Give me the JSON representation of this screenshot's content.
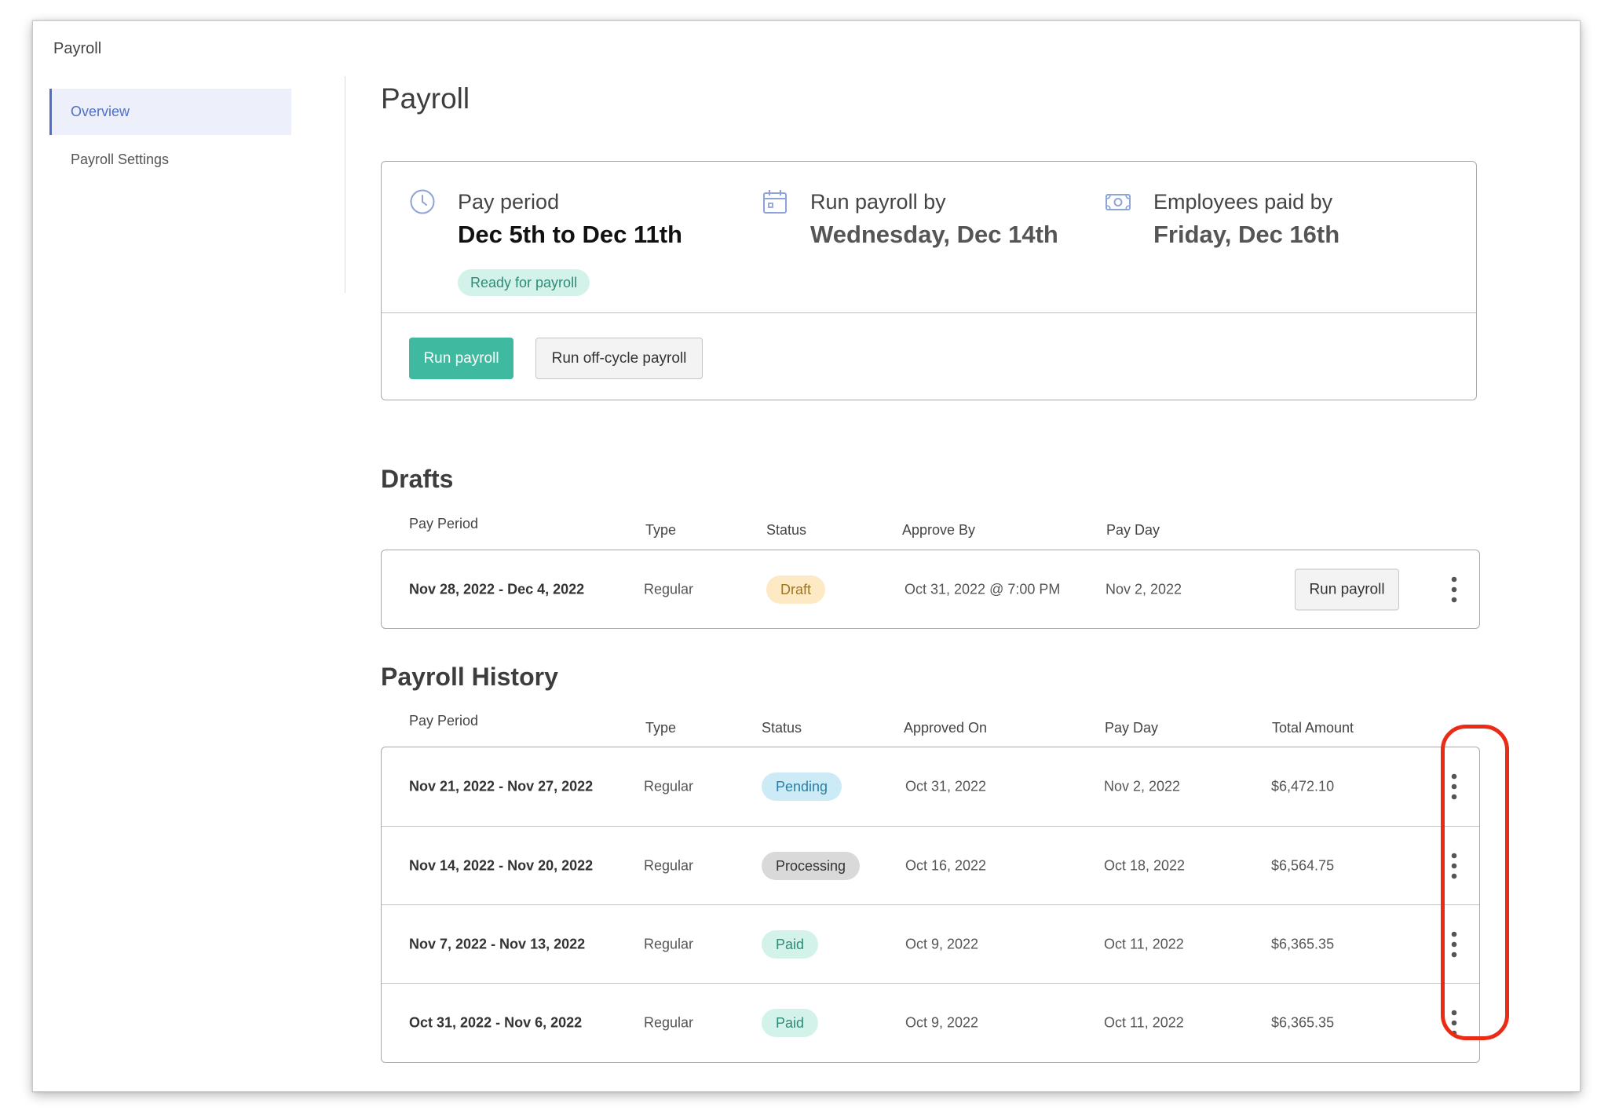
{
  "app": {
    "title": "Payroll"
  },
  "sidebar": {
    "items": [
      {
        "label": "Overview",
        "active": true
      },
      {
        "label": "Payroll Settings",
        "active": false
      }
    ]
  },
  "page": {
    "title": "Payroll"
  },
  "pay_period_card": {
    "pay_period_label": "Pay period",
    "pay_period_value": "Dec 5th to Dec 11th",
    "status_badge": "Ready for payroll",
    "run_by_label": "Run payroll by",
    "run_by_value": "Wednesday, Dec 14th",
    "paid_by_label": "Employees paid by",
    "paid_by_value": "Friday, Dec 16th",
    "run_payroll_button": "Run payroll",
    "off_cycle_button": "Run off-cycle payroll"
  },
  "drafts": {
    "title": "Drafts",
    "columns": [
      "Pay Period",
      "Type",
      "Status",
      "Approve By",
      "Pay Day"
    ],
    "rows": [
      {
        "pay_period": "Nov 28, 2022 - Dec 4, 2022",
        "type": "Regular",
        "status": "Draft",
        "approve_by": "Oct 31, 2022 @ 7:00 PM",
        "pay_day": "Nov 2, 2022",
        "action": "Run payroll"
      }
    ]
  },
  "history": {
    "title": "Payroll History",
    "columns": [
      "Pay Period",
      "Type",
      "Status",
      "Approved On",
      "Pay Day",
      "Total Amount"
    ],
    "rows": [
      {
        "pay_period": "Nov 21, 2022 - Nov 27, 2022",
        "type": "Regular",
        "status": "Pending",
        "approved_on": "Oct 31, 2022",
        "pay_day": "Nov 2, 2022",
        "total": "$6,472.10"
      },
      {
        "pay_period": "Nov 14, 2022 - Nov 20, 2022",
        "type": "Regular",
        "status": "Processing",
        "approved_on": "Oct 16, 2022",
        "pay_day": "Oct 18, 2022",
        "total": "$6,564.75"
      },
      {
        "pay_period": "Nov 7, 2022 - Nov 13, 2022",
        "type": "Regular",
        "status": "Paid",
        "approved_on": "Oct 9, 2022",
        "pay_day": "Oct 11, 2022",
        "total": "$6,365.35"
      },
      {
        "pay_period": "Oct 31, 2022 - Nov 6, 2022",
        "type": "Regular",
        "status": "Paid",
        "approved_on": "Oct 9, 2022",
        "pay_day": "Oct 11, 2022",
        "total": "$6,365.35"
      }
    ]
  },
  "icons": {
    "pay_period": "clock-icon",
    "run_by": "calendar-icon",
    "paid_by": "money-icon",
    "row_menu": "more-vertical-icon"
  },
  "colors": {
    "accent": "#3fb99f",
    "sidebar_active": "#4f6fc7",
    "highlight": "#ea2b16"
  }
}
